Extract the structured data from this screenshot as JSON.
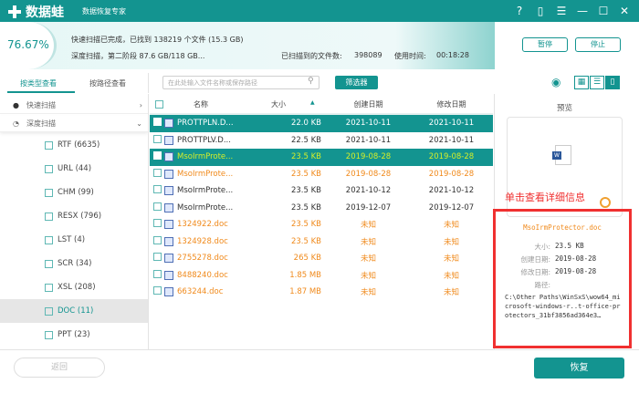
{
  "app": {
    "name": "数据蛙",
    "subtitle": "数据恢复专家"
  },
  "window": {
    "help": "?",
    "save": "▯",
    "menu": "☰",
    "minimize": "—",
    "maximize": "☐",
    "close": "✕"
  },
  "progress": {
    "percent_text": "76.67%",
    "percent": 76.67,
    "line1": "快速扫描已完成，已找到 138219 个文件 (15.3 GB)",
    "line2": "深度扫描，第二阶段 87.6 GB/118 GB...",
    "files_label": "已扫描到的文件数:",
    "files_value": "398089",
    "time_label": "使用时间:",
    "time_value": "00:18:28",
    "pause": "暂停",
    "stop": "停止"
  },
  "tabs": [
    {
      "label": "按类型查看",
      "active": true
    },
    {
      "label": "按路径查看",
      "active": false
    }
  ],
  "search": {
    "placeholder": "在此处输入文件名称或保存路径"
  },
  "filter_label": "筛选器",
  "sidebar": {
    "quick_scan": "快速扫描",
    "deep_scan": "深度扫描",
    "items": [
      "RTF (6635)",
      "URL (44)",
      "CHM (99)",
      "RESX (796)",
      "LST (4)",
      "SCR (34)",
      "XSL (208)",
      "DOC (11)",
      "PPT (23)"
    ],
    "selected": "DOC (11)"
  },
  "table": {
    "headers": [
      "名称",
      "大小",
      "创建日期",
      "修改日期"
    ],
    "rows": [
      {
        "name": "PROTTPLN.D...",
        "size": "22.0 KB",
        "created": "2021-10-11",
        "modified": "2021-10-11",
        "style": "sel"
      },
      {
        "name": "PROTTPLV.D...",
        "size": "22.5 KB",
        "created": "2021-10-11",
        "modified": "2021-10-11",
        "style": ""
      },
      {
        "name": "MsoIrmProte...",
        "size": "23.5 KB",
        "created": "2019-08-28",
        "modified": "2019-08-28",
        "style": "sel lime"
      },
      {
        "name": "MsoIrmProte...",
        "size": "23.5 KB",
        "created": "2019-08-28",
        "modified": "2019-08-28",
        "style": "orange"
      },
      {
        "name": "MsoIrmProte...",
        "size": "23.5 KB",
        "created": "2021-10-12",
        "modified": "2021-10-12",
        "style": ""
      },
      {
        "name": "MsoIrmProte...",
        "size": "23.5 KB",
        "created": "2019-12-07",
        "modified": "2019-12-07",
        "style": ""
      },
      {
        "name": "1324922.doc",
        "size": "23.5 KB",
        "created": "未知",
        "modified": "未知",
        "style": "orange"
      },
      {
        "name": "1324928.doc",
        "size": "23.5 KB",
        "created": "未知",
        "modified": "未知",
        "style": "orange"
      },
      {
        "name": "2755278.doc",
        "size": "265 KB",
        "created": "未知",
        "modified": "未知",
        "style": "orange"
      },
      {
        "name": "8488240.doc",
        "size": "1.85 MB",
        "created": "未知",
        "modified": "未知",
        "style": "orange"
      },
      {
        "name": "663244.doc",
        "size": "1.87 MB",
        "created": "未知",
        "modified": "未知",
        "style": "orange"
      }
    ]
  },
  "preview": {
    "title": "预览",
    "annotation": "单击查看详细信息",
    "filename": "MsoIrmProtector.doc",
    "size_label": "大小:",
    "size": "23.5 KB",
    "created_label": "创建日期:",
    "created": "2019-08-28",
    "modified_label": "修改日期:",
    "modified": "2019-08-28",
    "path_label": "路径:",
    "path": "C:\\Other Paths\\WinSxS\\wow64_microsoft-windows-r..t-office-protectors_31bf3856ad364e3…"
  },
  "buttons": {
    "back": "返回",
    "recover": "恢复"
  }
}
